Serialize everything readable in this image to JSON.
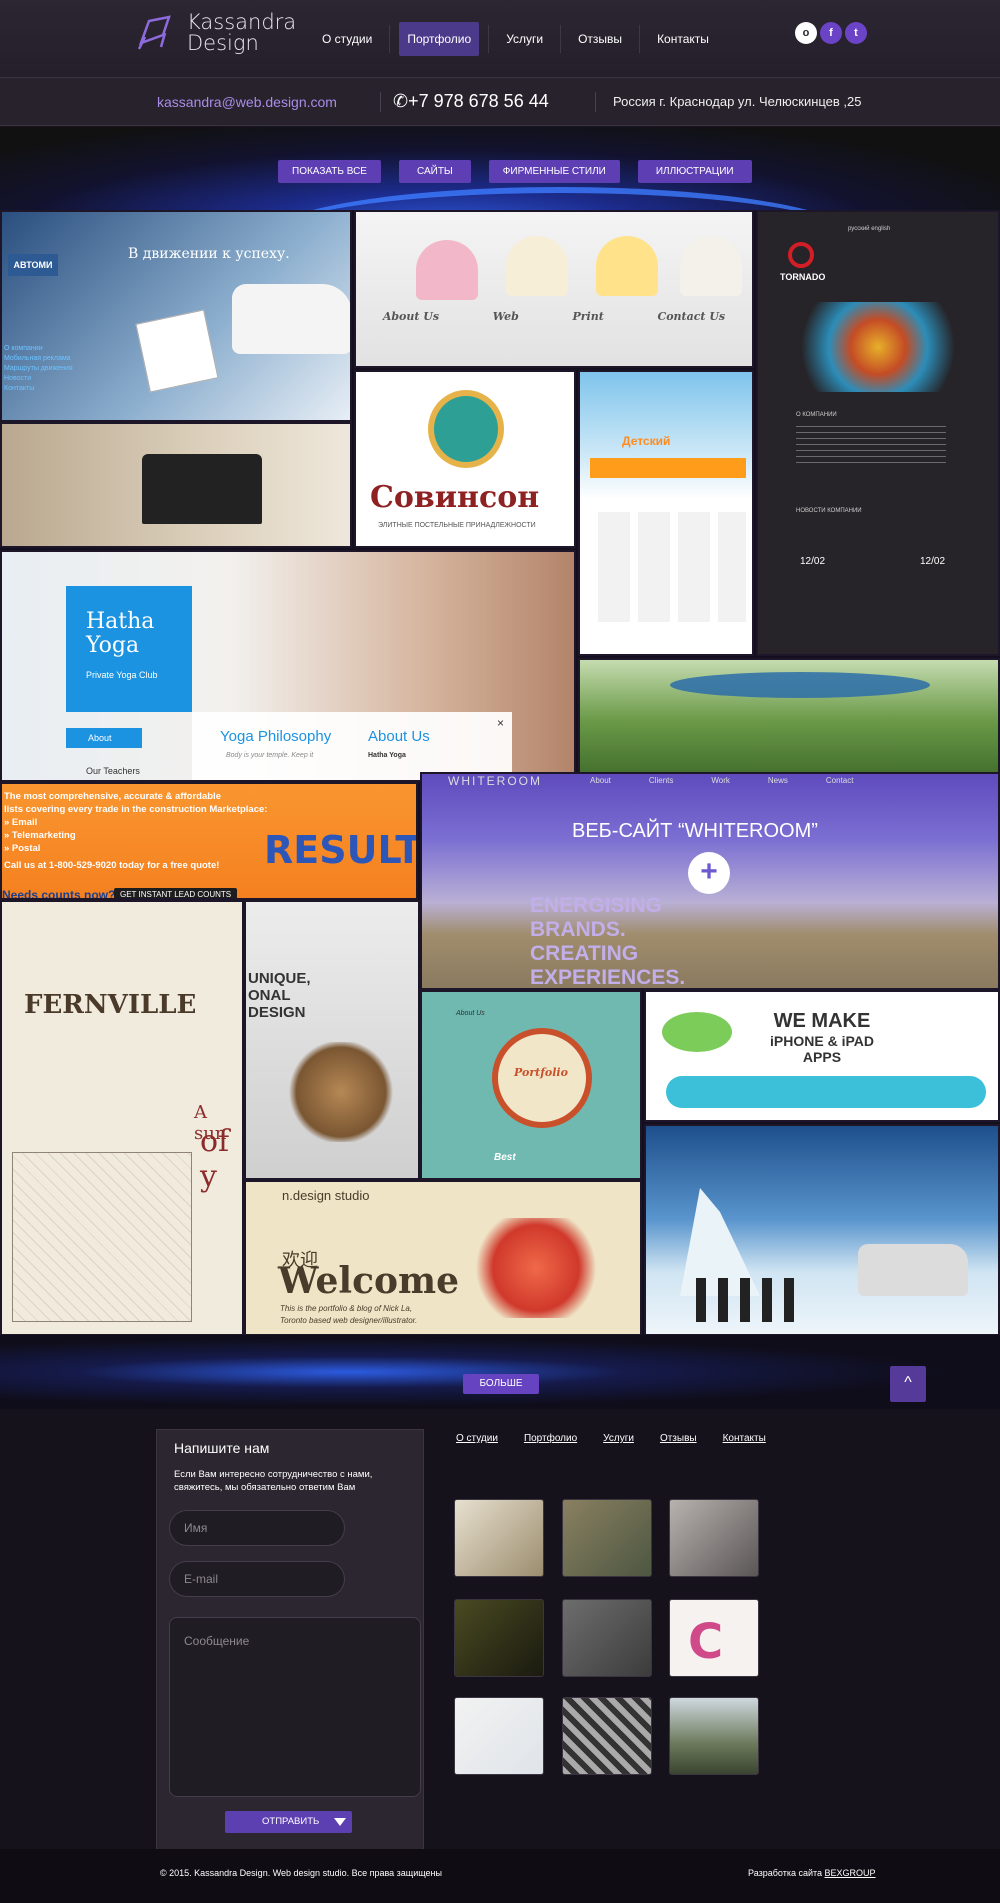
{
  "header": {
    "logo_line1": "Kassandra",
    "logo_line2": "Design",
    "nav": [
      "О студии",
      "Портфолио",
      "Услуги",
      "Отзывы",
      "Контакты"
    ],
    "active_nav": "Портфолио",
    "social": [
      {
        "name": "odnoklassniki-icon",
        "glyph": "о",
        "color": "#ffffff"
      },
      {
        "name": "facebook-icon",
        "glyph": "f",
        "color": "#6b43c6"
      },
      {
        "name": "twitter-icon",
        "glyph": "t",
        "color": "#6b43c6"
      }
    ]
  },
  "contact": {
    "email": "kassandra@web.design.com",
    "phone": "+7 978 678 56 44",
    "address": "Россия г. Краснодар ул. Челюскинцев ,25"
  },
  "filters": [
    "ПОКАЗАТЬ ВСЕ",
    "САЙТЫ",
    "ФИРМЕННЫЕ СТИЛИ",
    "ИЛЛЮСТРАЦИИ"
  ],
  "portfolio": {
    "tile_texts": {
      "avtomir": "В движении к успеху.",
      "avtomir_logo": "АВТОМИ",
      "avtomir_menu": [
        "О компании",
        "Мобильная реклама",
        "Маршруты движения",
        "Новости",
        "Контакты"
      ],
      "cupcakes": [
        "About Us",
        "Web",
        "Print",
        "Contact Us"
      ],
      "tornado": "TORNADO",
      "tornado_lang": [
        "русский",
        "english"
      ],
      "tornado_sections": [
        "О КОМПАНИИ",
        "НОВОСТИ КОМПАНИИ"
      ],
      "tornado_dates": [
        "12/02",
        "12/02"
      ],
      "sovinson_title": "Совинсон",
      "sovinson_sub": "ЭЛИТНЫЕ ПОСТЕЛЬНЫЕ ПРИНАДЛЕЖНОСТИ",
      "kids": "Детский",
      "hatha_title": "Hatha Yoga",
      "hatha_sub": "Private Yoga Club",
      "hatha_about": "About",
      "hatha_teachers": "Our Teachers",
      "yoga_philosophy": "Yoga Philosophy",
      "about_us": "About Us",
      "yoga_quote": "Body is your temple. Keep it",
      "yoga_hatha": "Hatha Yoga",
      "results_text": [
        "The most comprehensive, accurate & affordable",
        "lists covering every trade in the construction Marketplace:",
        "» Email",
        "» Telemarketing",
        "» Postal",
        "Call us at 1-800-529-9020 today for a free quote!"
      ],
      "results_word": "RESULTS",
      "results_needs": "Needs counts now?",
      "results_btn": "GET INSTANT LEAD COUNTS",
      "whiteroom_logo": "WHITEROOM",
      "whiteroom_nav": [
        "About",
        "Clients",
        "Work",
        "News",
        "Contact"
      ],
      "whiteroom_title": "ВЕБ-САЙТ “WHITEROOM”",
      "whiteroom_plus": "+",
      "whiteroom_lines": [
        "ENERGISING",
        "BRANDS.",
        "CREATING",
        "EXPERIENCES."
      ],
      "fernville": "FERNVILLE",
      "fernville_side": "A sun",
      "fernville_of": "of y",
      "octopus_text": [
        "UNIQUE,",
        "ONAL",
        "DESIGN"
      ],
      "portfolio_badge": "Portfolio",
      "about_badge": "About Us",
      "best_badge": "Best",
      "iphone": [
        "WE MAKE",
        "iPHONE & iPAD",
        "APPS"
      ],
      "ndesign": "n.design studio",
      "welcome_cn": "欢迎",
      "welcome": "Welcome",
      "welcome_sub1": "This is the portfolio & blog of Nick La,",
      "welcome_sub2": "Toronto based web designer/illustrator."
    }
  },
  "more_label": "БОЛЬШЕ",
  "top_label": "^",
  "footer": {
    "form_title": "Напишите нам",
    "form_text": "Если Вам интересно сотрудничество с нами, свяжитесь, мы обязательно ответим Вам",
    "name_placeholder": "Имя",
    "email_placeholder": "E-mail",
    "message_placeholder": "Сообщение",
    "send_label": "ОТПРАВИТЬ",
    "nav": [
      "О студии",
      "Портфолио",
      "Услуги",
      "Отзывы",
      "Контакты"
    ],
    "copyright": "© 2015. Kassandra Design. Web design studio.  Все права защищены",
    "dev_label": "Разработка сайта",
    "dev_link": "BEXGROUP"
  }
}
